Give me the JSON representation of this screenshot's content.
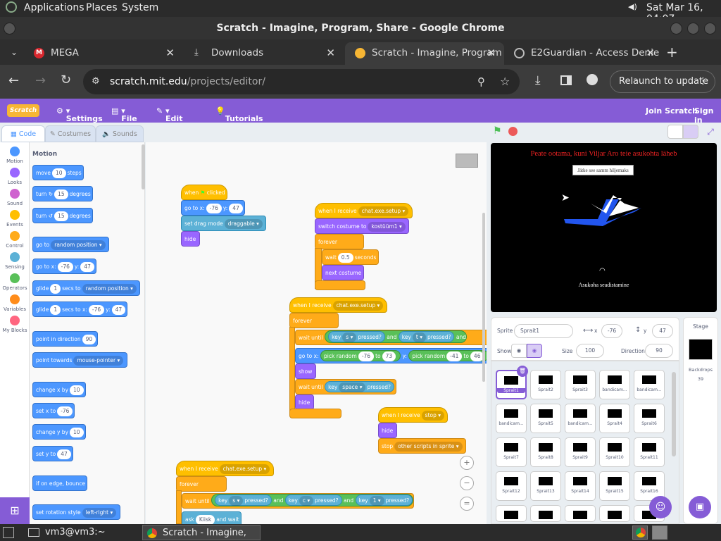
{
  "panel": {
    "applications": "Applications",
    "places": "Places",
    "system": "System",
    "clock": "Sat Mar 16, 04:07"
  },
  "window": {
    "title": "Scratch - Imagine, Program, Share - Google Chrome"
  },
  "tabs": [
    {
      "label": "MEGA"
    },
    {
      "label": "Downloads"
    },
    {
      "label": "Scratch - Imagine, Program"
    },
    {
      "label": "E2Guardian - Access Denie"
    }
  ],
  "omnibox": {
    "host": "scratch.mit.edu",
    "path": "/projects/editor/",
    "relaunch": "Relaunch to update"
  },
  "scratch_menu": {
    "logo": "Scratch",
    "settings": "Settings",
    "file": "File",
    "edit": "Edit",
    "tutorials": "Tutorials",
    "join": "Join Scratch",
    "signin": "Sign in"
  },
  "editor_tabs": {
    "code": "Code",
    "costumes": "Costumes",
    "sounds": "Sounds"
  },
  "categories": [
    {
      "label": "Motion",
      "color": "#4c97ff"
    },
    {
      "label": "Looks",
      "color": "#9966ff"
    },
    {
      "label": "Sound",
      "color": "#cf63cf"
    },
    {
      "label": "Events",
      "color": "#ffbf00"
    },
    {
      "label": "Control",
      "color": "#ffab19"
    },
    {
      "label": "Sensing",
      "color": "#5cb1d6"
    },
    {
      "label": "Operators",
      "color": "#59c059"
    },
    {
      "label": "Variables",
      "color": "#ff8c1a"
    },
    {
      "label": "My Blocks",
      "color": "#ff6680"
    }
  ],
  "palette": {
    "heading": "Motion",
    "move": "move",
    "move_n": "10",
    "steps": "steps",
    "turn": "turn",
    "turn_cw_n": "15",
    "degrees": "degrees",
    "turn_ccw_n": "15",
    "goto": "go to",
    "random_position": "random position",
    "goto_xy": "go to x:",
    "x": "-76",
    "y_label": "y:",
    "y": "47",
    "glide": "glide",
    "glide_n": "1",
    "secs_to": "secs to",
    "secs_to_x": "secs to x:",
    "point_dir": "point in direction",
    "dir": "90",
    "point_towards": "point towards",
    "mouse_pointer": "mouse-pointer",
    "change_x": "change x by",
    "change_x_n": "10",
    "set_x": "set x to",
    "set_x_n": "-76",
    "change_y": "change y by",
    "change_y_n": "10",
    "set_y": "set y to",
    "set_y_n": "47",
    "bounce": "if on edge, bounce",
    "rotation": "set rotation style",
    "left_right": "left-right"
  },
  "scripts": {
    "when_flag": "when",
    "clicked": "clicked",
    "goto_xy": "go to x:",
    "x": "-76",
    "y_label": "y:",
    "y": "47",
    "drag": "set drag mode",
    "draggable": "draggable",
    "hide": "hide",
    "when_receive": "when I receive",
    "msg1": "chat.exe.setup",
    "switch_costume": "switch costume to",
    "costume": "kostüüm1",
    "forever": "forever",
    "wait": "wait",
    "wait_n": "0.5",
    "seconds": "seconds",
    "next_costume": "next costume",
    "msg2": "chat.exe.setup",
    "wait_until": "wait until",
    "key": "key",
    "s": "s",
    "pressed": "pressed?",
    "and": "and",
    "t": "t",
    "pick_random": "pick random",
    "r1": "-76",
    "to": "to",
    "r2": "73",
    "r3": "-41",
    "r4": "46",
    "show": "show",
    "space": "space",
    "msg3": "stop",
    "stop": "stop",
    "other_scripts": "other scripts in sprite",
    "msg4": "chat.exe.setup",
    "c": "c",
    "one": "1",
    "ask": "ask",
    "kiisk": "Kiisk",
    "and_wait": "and wait"
  },
  "stage": {
    "text1": "Peate ootama, kuni Viljar Aro teie asukohta läheb",
    "button": "Jätke see samm hiljemaks",
    "text2": "Asukoha seadistamine"
  },
  "sprite_info": {
    "label": "Sprite",
    "name": "Sprait1",
    "x_label": "x",
    "x": "-76",
    "y_label": "y",
    "y": "47",
    "show": "Show",
    "size_label": "Size",
    "size": "100",
    "direction_label": "Direction",
    "direction": "90"
  },
  "sprites": [
    "Sprait1",
    "Sprait2",
    "Sprait3",
    "bandicam...",
    "bandicam...",
    "bandicam...",
    "Sprait5",
    "bandicam...",
    "Sprait4",
    "Sprait6",
    "Sprait7",
    "Sprait8",
    "Sprait9",
    "Sprait10",
    "Sprait11",
    "Sprait12",
    "Sprait13",
    "Sprait14",
    "Sprait15",
    "Sprait16",
    "",
    "",
    "",
    "",
    ""
  ],
  "stage_panel": {
    "title": "Stage",
    "backdrops": "Backdrops",
    "count": "39"
  },
  "taskbar": {
    "terminal": "vm3@vm3:~",
    "chrome": "Scratch - Imagine, P..."
  }
}
